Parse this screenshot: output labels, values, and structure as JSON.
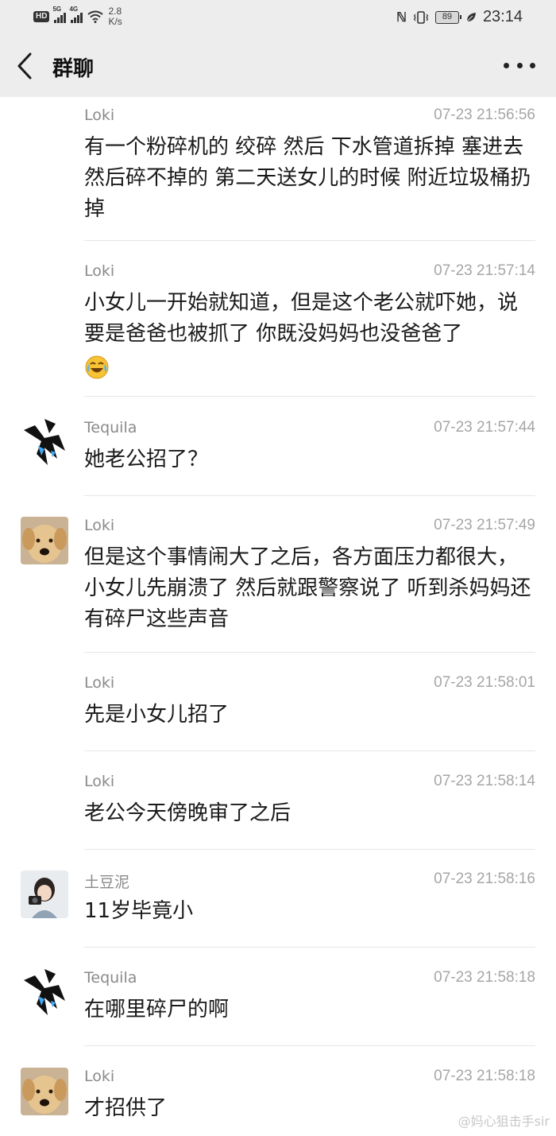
{
  "status_bar": {
    "hd_badge": "HD",
    "signal1_label": "5G",
    "signal2_label": "4G",
    "speed_value": "2.8",
    "speed_unit": "K/s",
    "battery": "89",
    "time": "23:14"
  },
  "nav": {
    "title": "群聊"
  },
  "messages": [
    {
      "sender": "Loki",
      "time": "07-23 21:56:56",
      "avatar": "",
      "text": "有一个粉碎机的 绞碎 然后 下水管道拆掉 塞进去 然后碎不掉的 第二天送女儿的时候 附近垃圾桶扔掉"
    },
    {
      "sender": "Loki",
      "time": "07-23 21:57:14",
      "avatar": "",
      "text": "小女儿一开始就知道，但是这个老公就吓她，说要是爸爸也被抓了 你既没妈妈也没爸爸了",
      "emoji": "crying-laughing-emoji"
    },
    {
      "sender": "Tequila",
      "time": "07-23 21:57:44",
      "avatar": "dark-sketch-avatar",
      "text": "她老公招了？"
    },
    {
      "sender": "Loki",
      "time": "07-23 21:57:49",
      "avatar": "dog-avatar",
      "text": "但是这个事情闹大了之后，各方面压力都很大，小女儿先崩溃了 然后就跟警察说了 听到杀妈妈还有碎尸这些声音"
    },
    {
      "sender": "Loki",
      "time": "07-23 21:58:01",
      "avatar": "",
      "text": "先是小女儿招了"
    },
    {
      "sender": "Loki",
      "time": "07-23 21:58:14",
      "avatar": "",
      "text": "老公今天傍晚审了之后"
    },
    {
      "sender": "土豆泥",
      "time": "07-23 21:58:16",
      "avatar": "camera-girl-avatar",
      "text": "11岁毕竟小"
    },
    {
      "sender": "Tequila",
      "time": "07-23 21:58:18",
      "avatar": "dark-sketch-avatar",
      "text": "在哪里碎尸的啊"
    },
    {
      "sender": "Loki",
      "time": "07-23 21:58:18",
      "avatar": "dog-avatar",
      "text": "才招供了"
    }
  ],
  "watermark": "@妈心狙击手sir",
  "colors": {
    "header_bg": "#ededed",
    "list_bg": "#ffffff",
    "meta_text": "#8a8a8a",
    "divider": "#e6e6e6"
  }
}
